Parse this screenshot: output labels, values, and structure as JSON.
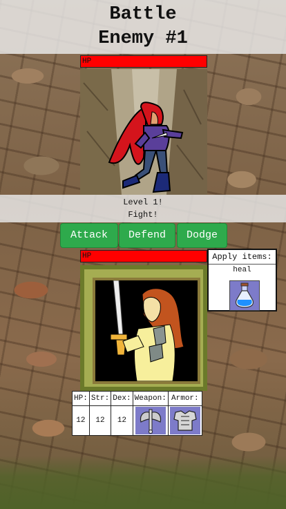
{
  "header": {
    "line1": "Battle",
    "line2": "Enemy #1"
  },
  "enemy": {
    "hp_label": "HP",
    "hp_fraction": 1.0
  },
  "status": {
    "level_text": "Level 1!",
    "fight_text": "Fight!"
  },
  "actions": {
    "attack": "Attack",
    "defend": "Defend",
    "dodge": "Dodge"
  },
  "player": {
    "hp_label": "HP",
    "hp_fraction": 1.0
  },
  "items_panel": {
    "header": "Apply items:",
    "items": [
      {
        "name": "heal",
        "icon": "potion-icon"
      }
    ]
  },
  "stats": {
    "headers": [
      "HP:",
      "Str:",
      "Dex:",
      "Weapon:",
      "Armor:"
    ],
    "hp": "12",
    "str": "12",
    "dex": "12",
    "weapon_icon": "axe-icon",
    "armor_icon": "armor-icon"
  },
  "colors": {
    "hp_bar": "#ff0000",
    "button": "#2eaa4c",
    "item_bg": "#7d7bc9"
  }
}
